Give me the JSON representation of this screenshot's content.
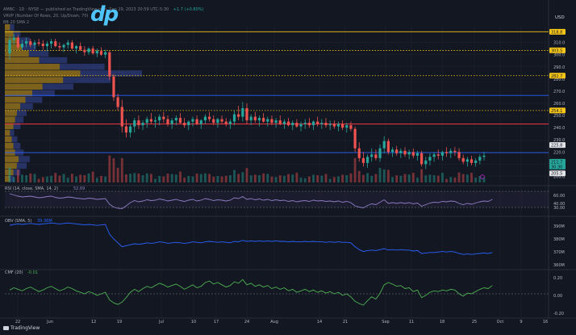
{
  "header": {
    "line1": "AMBC · 1D · NYSE — published on TradingView.com, Sep 29, 2023 20:59 UTC-5:30",
    "line1_change": "+1.7 (+0.80%)",
    "line2": "VRVP (Number Of Rows, 20, Up/Down, 70)",
    "line3": "BB 20 SMA 2"
  },
  "currency": "USD",
  "watermark": "dp",
  "footer_brand": "TradingView",
  "colors": {
    "background": "#131722",
    "up": "#26a69a",
    "down": "#ef5350",
    "blue_line": "#2962ff",
    "red_line": "#f23645",
    "yellow": "#f5c518",
    "rsi": "#8e7cc3",
    "obv": "#2962ff",
    "cmf": "#4caf50"
  },
  "chart_data": [
    {
      "type": "candlestick",
      "panel": "price",
      "ylim": [
        195,
        325
      ],
      "y_ticks": [
        310,
        300,
        290,
        280,
        270,
        260,
        250,
        240,
        230,
        220,
        210,
        200
      ],
      "x_ticks": [
        "22",
        "Jun",
        "12",
        "19",
        "Jul",
        "10",
        "17",
        "24",
        "Aug",
        "14",
        "21",
        "Sep",
        "11",
        "18",
        "25",
        "Oct",
        "9",
        "16"
      ],
      "horizontal_levels": [
        {
          "value": 318.8,
          "color": "#f5c518",
          "style": "solid"
        },
        {
          "value": 303.5,
          "color": "#f5c518",
          "style": "dotted"
        },
        {
          "value": 282.7,
          "color": "#f5c518",
          "style": "dotted"
        },
        {
          "value": 266.5,
          "color": "#2962ff",
          "style": "solid"
        },
        {
          "value": 254.1,
          "color": "#f5c518",
          "style": "dotted"
        },
        {
          "value": 243,
          "color": "#f23645",
          "style": "solid"
        },
        {
          "value": 219.5,
          "color": "#2962ff",
          "style": "solid"
        }
      ],
      "price_labels": [
        {
          "text": "318.8",
          "value": 318.8,
          "bg": "#f5c518"
        },
        {
          "text": "303.5",
          "value": 303.5,
          "bg": "#f5c518"
        },
        {
          "text": "282.7",
          "value": 282.7,
          "bg": "#f5c518"
        },
        {
          "text": "254.1",
          "value": 254.1,
          "bg": "#f5c518"
        },
        {
          "text": "225.8",
          "value": 225.8,
          "bg": "#e1e3e6"
        },
        {
          "text": "211.7",
          "value": 212,
          "bg": "#26a69a"
        },
        {
          "text": "30.30",
          "value": 208,
          "bg": "#26a69a"
        },
        {
          "text": "205.5",
          "value": 202.5,
          "bg": "#e1e3e6"
        }
      ],
      "candles": [
        [
          301,
          315,
          296,
          312
        ],
        [
          312,
          317,
          308,
          314
        ],
        [
          314,
          316,
          304,
          306
        ],
        [
          306,
          312,
          304,
          309
        ],
        [
          309,
          314,
          306,
          311
        ],
        [
          311,
          313,
          306,
          308
        ],
        [
          308,
          312,
          305,
          310
        ],
        [
          310,
          313,
          307,
          309
        ],
        [
          309,
          312,
          304,
          307
        ],
        [
          307,
          311,
          303,
          309
        ],
        [
          309,
          313,
          305,
          311
        ],
        [
          311,
          313,
          306,
          307
        ],
        [
          307,
          310,
          303,
          306
        ],
        [
          306,
          309,
          302,
          308
        ],
        [
          308,
          312,
          305,
          310
        ],
        [
          310,
          312,
          304,
          305
        ],
        [
          305,
          308,
          301,
          307
        ],
        [
          307,
          310,
          303,
          304
        ],
        [
          304,
          307,
          299,
          302
        ],
        [
          302,
          306,
          300,
          305
        ],
        [
          305,
          307,
          300,
          301
        ],
        [
          301,
          305,
          298,
          303
        ],
        [
          303,
          306,
          299,
          300
        ],
        [
          300,
          304,
          297,
          302
        ],
        [
          302,
          303,
          279,
          282
        ],
        [
          282,
          284,
          262,
          265
        ],
        [
          265,
          268,
          254,
          257
        ],
        [
          257,
          263,
          236,
          241
        ],
        [
          241,
          247,
          232,
          236
        ],
        [
          236,
          243,
          232,
          241
        ],
        [
          241,
          248,
          236,
          246
        ],
        [
          246,
          250,
          239,
          242
        ],
        [
          242,
          246,
          238,
          244
        ],
        [
          244,
          249,
          240,
          247
        ],
        [
          247,
          252,
          243,
          245
        ],
        [
          245,
          249,
          240,
          246
        ],
        [
          246,
          251,
          242,
          249
        ],
        [
          249,
          253,
          244,
          247
        ],
        [
          247,
          250,
          241,
          243
        ],
        [
          243,
          248,
          239,
          246
        ],
        [
          246,
          250,
          242,
          248
        ],
        [
          248,
          252,
          243,
          244
        ],
        [
          244,
          248,
          240,
          242
        ],
        [
          242,
          246,
          238,
          245
        ],
        [
          245,
          249,
          241,
          247
        ],
        [
          247,
          250,
          242,
          243
        ],
        [
          243,
          247,
          239,
          246
        ],
        [
          246,
          251,
          243,
          249
        ],
        [
          249,
          253,
          245,
          247
        ],
        [
          247,
          250,
          242,
          244
        ],
        [
          244,
          248,
          240,
          247
        ],
        [
          247,
          250,
          243,
          245
        ],
        [
          245,
          248,
          241,
          243
        ],
        [
          243,
          247,
          239,
          245
        ],
        [
          245,
          254,
          242,
          251
        ],
        [
          251,
          258,
          246,
          249
        ],
        [
          249,
          261,
          245,
          256
        ],
        [
          256,
          260,
          243,
          246
        ],
        [
          246,
          251,
          242,
          249
        ],
        [
          249,
          253,
          244,
          246
        ],
        [
          246,
          250,
          241,
          248
        ],
        [
          248,
          252,
          244,
          245
        ],
        [
          245,
          249,
          241,
          247
        ],
        [
          247,
          250,
          242,
          244
        ],
        [
          244,
          248,
          240,
          246
        ],
        [
          246,
          250,
          242,
          243
        ],
        [
          243,
          247,
          239,
          245
        ],
        [
          245,
          248,
          241,
          242
        ],
        [
          242,
          246,
          238,
          244
        ],
        [
          244,
          247,
          240,
          241
        ],
        [
          241,
          245,
          237,
          243
        ],
        [
          243,
          247,
          239,
          244
        ],
        [
          244,
          248,
          240,
          242
        ],
        [
          242,
          246,
          238,
          245
        ],
        [
          245,
          249,
          241,
          243
        ],
        [
          243,
          247,
          239,
          244
        ],
        [
          244,
          248,
          240,
          242
        ],
        [
          242,
          246,
          238,
          243
        ],
        [
          243,
          246,
          239,
          241
        ],
        [
          241,
          245,
          237,
          243
        ],
        [
          243,
          246,
          238,
          240
        ],
        [
          240,
          244,
          236,
          242
        ],
        [
          242,
          245,
          237,
          239
        ],
        [
          239,
          241,
          220,
          223
        ],
        [
          223,
          228,
          212,
          215
        ],
        [
          215,
          220,
          208,
          211
        ],
        [
          211,
          218,
          207,
          216
        ],
        [
          216,
          223,
          212,
          218
        ],
        [
          218,
          222,
          213,
          215
        ],
        [
          215,
          226,
          212,
          223
        ],
        [
          223,
          233,
          219,
          229
        ],
        [
          229,
          231,
          218,
          220
        ],
        [
          220,
          224,
          216,
          222
        ],
        [
          222,
          225,
          217,
          219
        ],
        [
          219,
          223,
          215,
          221
        ],
        [
          221,
          224,
          216,
          218
        ],
        [
          218,
          222,
          214,
          220
        ],
        [
          220,
          223,
          215,
          217
        ],
        [
          217,
          221,
          213,
          219
        ],
        [
          219,
          221,
          208,
          210
        ],
        [
          210,
          216,
          206,
          213
        ],
        [
          213,
          219,
          209,
          216
        ],
        [
          216,
          220,
          212,
          218
        ],
        [
          218,
          222,
          214,
          217
        ],
        [
          217,
          221,
          213,
          220
        ],
        [
          220,
          224,
          216,
          219
        ],
        [
          219,
          223,
          215,
          221
        ],
        [
          221,
          224,
          217,
          220
        ],
        [
          220,
          223,
          213,
          215
        ],
        [
          215,
          218,
          210,
          212
        ],
        [
          212,
          216,
          208,
          214
        ],
        [
          214,
          217,
          209,
          211
        ],
        [
          211,
          215,
          208,
          213
        ],
        [
          213,
          218,
          210,
          216
        ],
        [
          216,
          220,
          213,
          217
        ]
      ],
      "volume_profile": [
        3,
        5,
        7,
        8,
        6,
        5,
        4,
        3,
        5,
        6,
        7,
        9,
        12,
        16,
        22,
        34,
        44,
        32,
        20,
        14,
        10,
        8,
        5,
        3
      ],
      "volume_profile_range": [
        195,
        325
      ]
    },
    {
      "type": "line",
      "panel": "rsi",
      "title": "RSI (14, close, SMA, 14, 2)",
      "title_value": "52.69",
      "ylim": [
        20,
        80
      ],
      "y_ticks": [
        60,
        40,
        30
      ],
      "band": [
        30,
        70
      ],
      "values": [
        64,
        61,
        58,
        56,
        57,
        58,
        56,
        54,
        55,
        57,
        58,
        55,
        53,
        54,
        56,
        55,
        53,
        52,
        51,
        53,
        52,
        50,
        51,
        52,
        38,
        31,
        28,
        27,
        34,
        42,
        47,
        44,
        46,
        49,
        47,
        48,
        51,
        49,
        46,
        48,
        50,
        47,
        45,
        48,
        50,
        46,
        48,
        52,
        50,
        47,
        49,
        48,
        46,
        48,
        54,
        52,
        57,
        50,
        52,
        49,
        51,
        48,
        50,
        47,
        49,
        47,
        48,
        45,
        47,
        44,
        46,
        47,
        45,
        48,
        46,
        47,
        45,
        46,
        44,
        46,
        43,
        45,
        42,
        34,
        31,
        29,
        35,
        39,
        37,
        43,
        49,
        40,
        42,
        40,
        42,
        40,
        42,
        39,
        41,
        33,
        37,
        41,
        43,
        42,
        45,
        44,
        46,
        45,
        40,
        37,
        40,
        38,
        41,
        44,
        46,
        45,
        50
      ]
    },
    {
      "type": "line",
      "panel": "obv",
      "title": "OBV (SMA, 5)",
      "title_value": "39.36M",
      "ylim": [
        0,
        100
      ],
      "y_ticks": [
        "390M",
        "380M",
        "370M",
        "360M"
      ],
      "values": [
        88,
        90,
        91,
        90,
        91,
        92,
        91,
        90,
        91,
        92,
        93,
        92,
        91,
        92,
        93,
        92,
        91,
        90,
        89,
        90,
        89,
        88,
        89,
        90,
        70,
        60,
        52,
        44,
        46,
        48,
        50,
        49,
        50,
        52,
        51,
        52,
        54,
        53,
        51,
        52,
        53,
        52,
        51,
        52,
        54,
        53,
        52,
        54,
        55,
        54,
        53,
        54,
        53,
        52,
        55,
        54,
        57,
        55,
        56,
        55,
        56,
        55,
        56,
        55,
        56,
        55,
        55,
        54,
        55,
        54,
        54,
        55,
        54,
        55,
        54,
        54,
        53,
        54,
        53,
        54,
        53,
        53,
        52,
        44,
        38,
        34,
        36,
        37,
        36,
        38,
        40,
        37,
        38,
        37,
        38,
        37,
        37,
        35,
        36,
        30,
        31,
        32,
        32,
        33,
        34,
        33,
        34,
        33,
        30,
        28,
        29,
        28,
        29,
        30,
        31,
        30,
        32
      ]
    },
    {
      "type": "line",
      "panel": "cmf",
      "title": "CMF (20)",
      "title_value": "-0.01",
      "ylim": [
        -0.3,
        0.3
      ],
      "y_ticks": [
        "0.20",
        "0.00",
        "-0.20"
      ],
      "values": [
        0.05,
        0.08,
        0.06,
        0.04,
        0.07,
        0.09,
        0.06,
        0.03,
        0.05,
        0.08,
        0.1,
        0.07,
        0.04,
        0.06,
        0.09,
        0.07,
        0.04,
        0.02,
        0.0,
        0.03,
        0.01,
        -0.02,
        0.0,
        0.02,
        -0.08,
        -0.12,
        -0.14,
        -0.11,
        -0.05,
        0.02,
        0.06,
        0.03,
        0.07,
        0.1,
        0.08,
        0.11,
        0.14,
        0.12,
        0.09,
        0.11,
        0.13,
        0.1,
        0.06,
        0.09,
        0.12,
        0.08,
        0.1,
        0.15,
        0.17,
        0.13,
        0.15,
        0.12,
        0.09,
        0.11,
        0.16,
        0.14,
        0.19,
        0.12,
        0.14,
        0.1,
        0.12,
        0.09,
        0.11,
        0.07,
        0.09,
        0.06,
        0.08,
        0.04,
        0.06,
        0.02,
        0.04,
        0.06,
        0.03,
        0.05,
        0.02,
        0.04,
        0.01,
        0.03,
        0.0,
        0.02,
        -0.02,
        0.0,
        -0.04,
        -0.1,
        -0.13,
        -0.15,
        -0.09,
        -0.04,
        -0.07,
        0.01,
        0.12,
        0.15,
        0.13,
        0.1,
        0.11,
        0.07,
        0.08,
        0.03,
        0.05,
        -0.05,
        -0.02,
        0.02,
        0.04,
        0.03,
        0.05,
        0.04,
        0.06,
        0.05,
        0.0,
        -0.03,
        0.01,
        0.0,
        0.03,
        0.06,
        0.08,
        0.07,
        0.11
      ]
    }
  ]
}
